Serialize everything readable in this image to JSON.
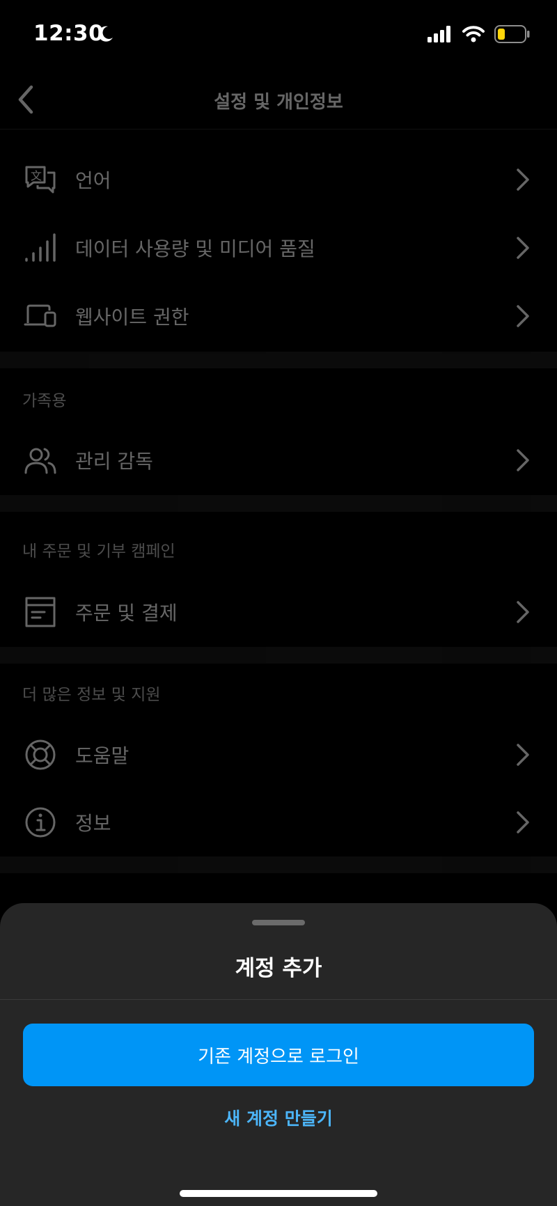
{
  "status_bar": {
    "time": "12:30",
    "icons": [
      "moon-icon",
      "signal-icon",
      "wifi-icon",
      "battery-icon"
    ],
    "battery_color": "#ffd60a"
  },
  "nav": {
    "title": "설정 및 개인정보",
    "back_icon": "chevron-left-icon"
  },
  "sections": {
    "general": {
      "items": [
        {
          "label": "언어",
          "icon": "translate-icon"
        },
        {
          "label": "데이터 사용량 및 미디어 품질",
          "icon": "signal-bars-icon"
        },
        {
          "label": "웹사이트 권한",
          "icon": "devices-icon"
        }
      ]
    },
    "family": {
      "header": "가족용",
      "items": [
        {
          "label": "관리 감독",
          "icon": "people-icon"
        }
      ]
    },
    "orders": {
      "header": "내 주문 및 기부 캠페인",
      "items": [
        {
          "label": "주문 및 결제",
          "icon": "order-box-icon"
        }
      ]
    },
    "support": {
      "header": "더 많은 정보 및 지원",
      "items": [
        {
          "label": "도움말",
          "icon": "lifebuoy-icon"
        },
        {
          "label": "정보",
          "icon": "info-icon"
        }
      ]
    }
  },
  "sheet": {
    "title": "계정 추가",
    "primary_button": "기존 계정으로 로그인",
    "secondary_link": "새 계정 만들기",
    "accent_color": "#0095f6",
    "link_color": "#4cb5f9"
  }
}
